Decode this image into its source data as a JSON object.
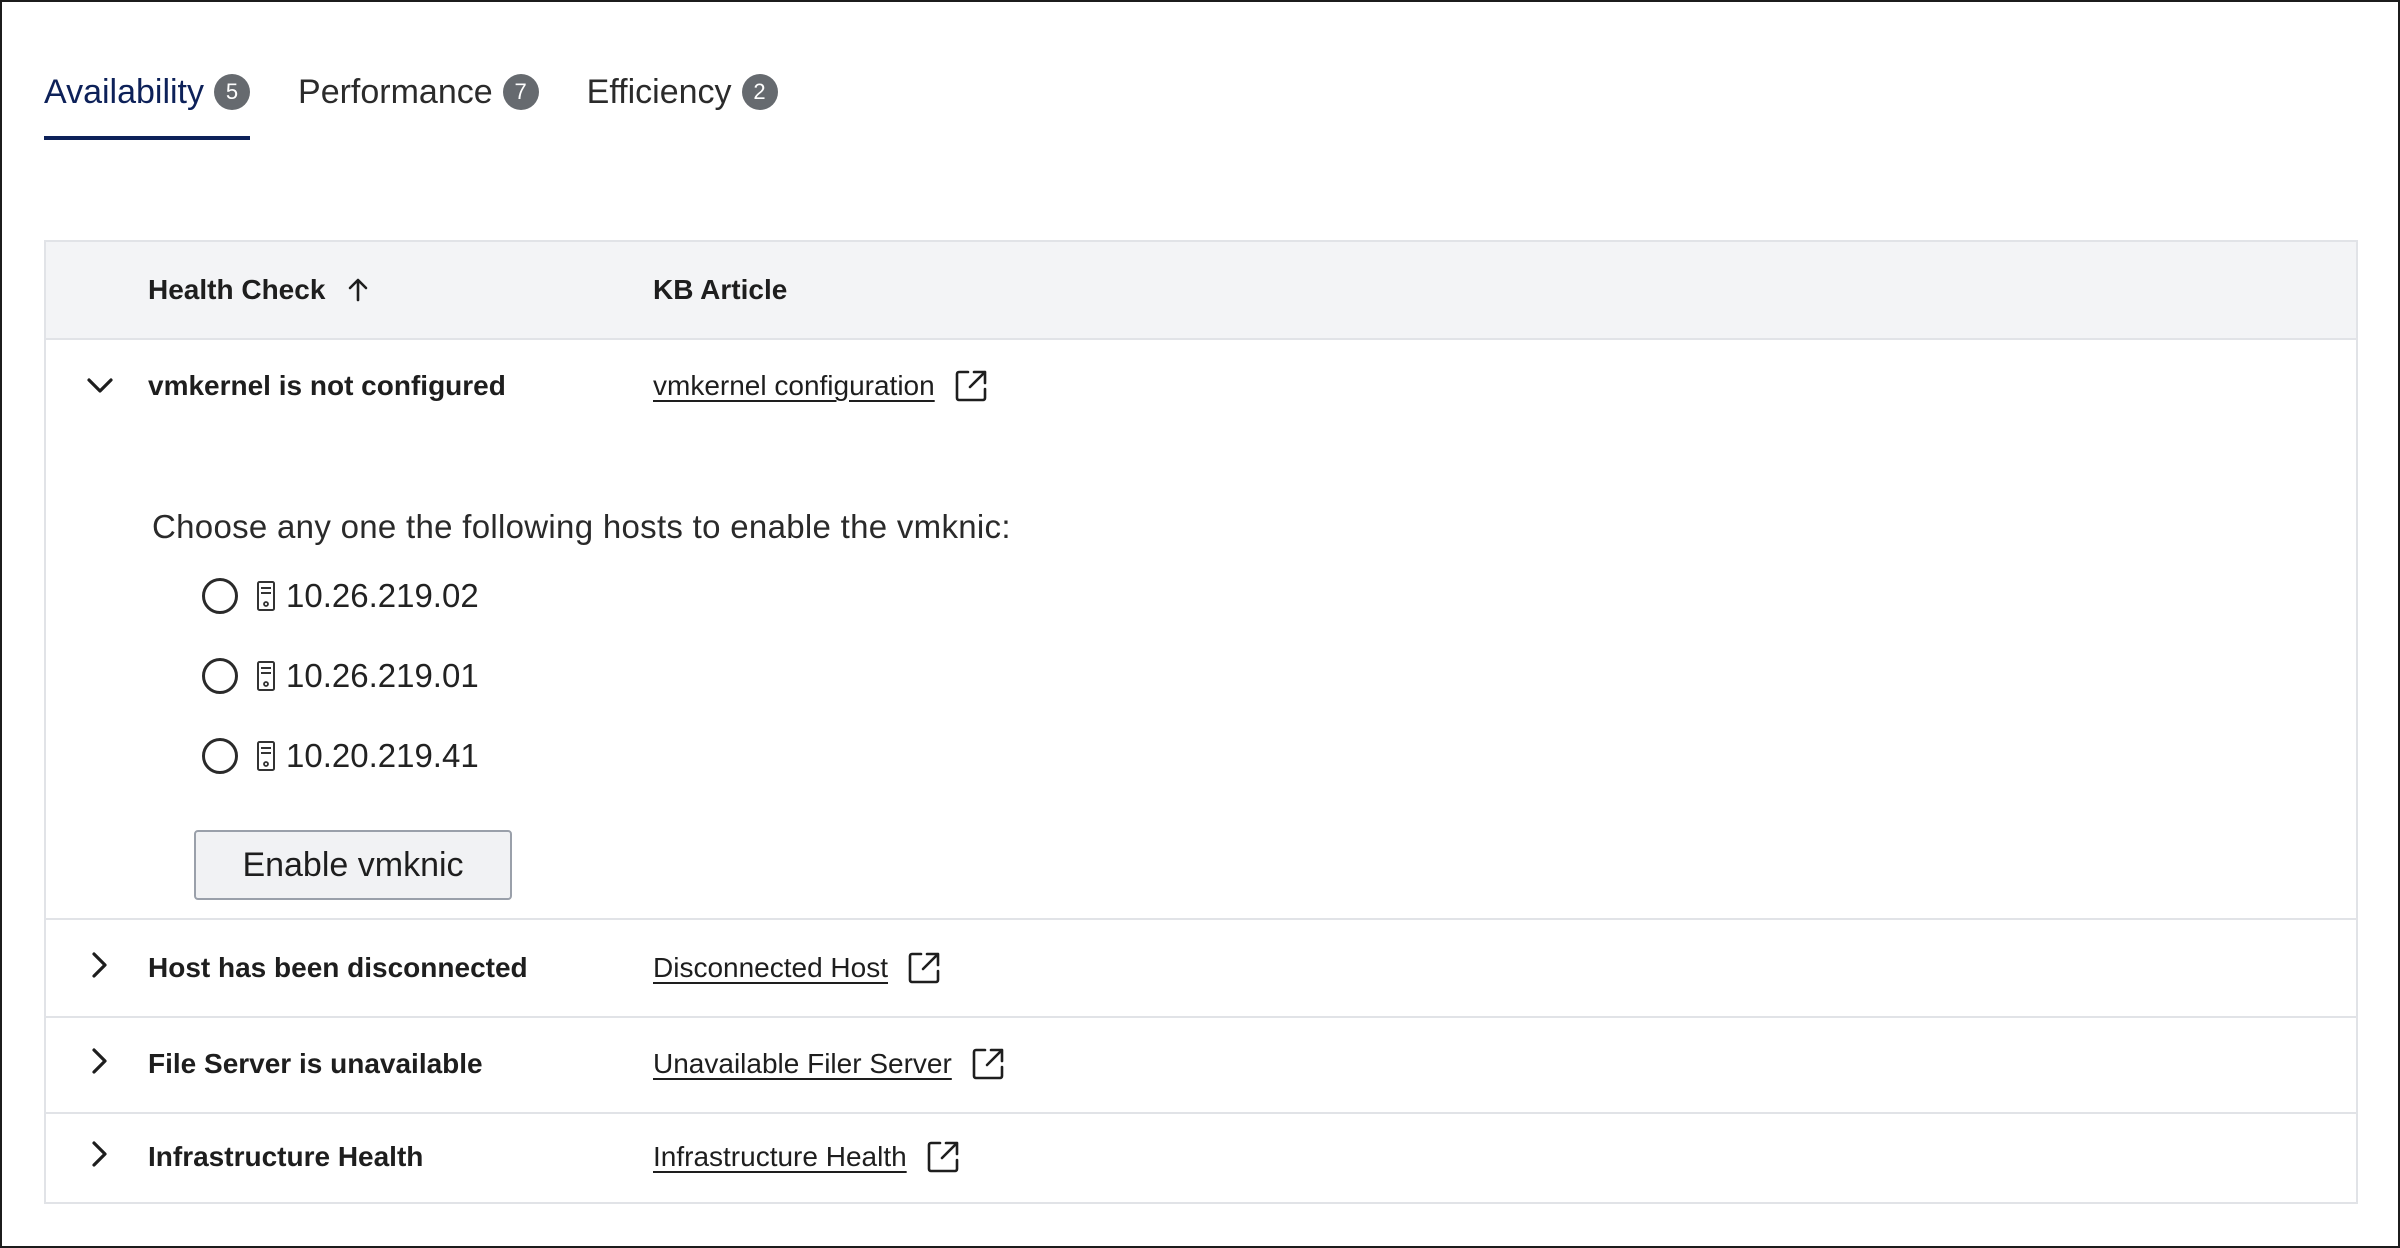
{
  "tabs": [
    {
      "label": "Availability",
      "count": "5",
      "active": true
    },
    {
      "label": "Performance",
      "count": "7",
      "active": false
    },
    {
      "label": "Efficiency",
      "count": "2",
      "active": false
    }
  ],
  "table": {
    "headers": {
      "health_check": "Health Check",
      "kb_article": "KB Article"
    },
    "rows": [
      {
        "health_check": "vmkernel is not configured",
        "kb_article": "vmkernel configuration",
        "expanded": true
      },
      {
        "health_check": "Host has been disconnected",
        "kb_article": "Disconnected Host",
        "expanded": false
      },
      {
        "health_check": "File Server is unavailable",
        "kb_article": "Unavailable Filer Server",
        "expanded": false
      },
      {
        "health_check": "Infrastructure Health",
        "kb_article": "Infrastructure Health",
        "expanded": false
      }
    ]
  },
  "panel": {
    "title": "Choose any one the following hosts to enable the vmknic:",
    "hosts": [
      "10.26.219.02",
      "10.26.219.01",
      "10.20.219.41"
    ],
    "button_label": "Enable vmknic"
  },
  "icons": {
    "sort": "arrow-up-icon",
    "external_link": "external-link-icon",
    "host": "server-icon",
    "expand": "chevron-right-icon",
    "collapse": "chevron-down-icon"
  },
  "colors": {
    "accent": "#0d2159",
    "badge": "#666a6f",
    "header_bg": "#f3f4f6",
    "border": "#e1e3e7"
  }
}
